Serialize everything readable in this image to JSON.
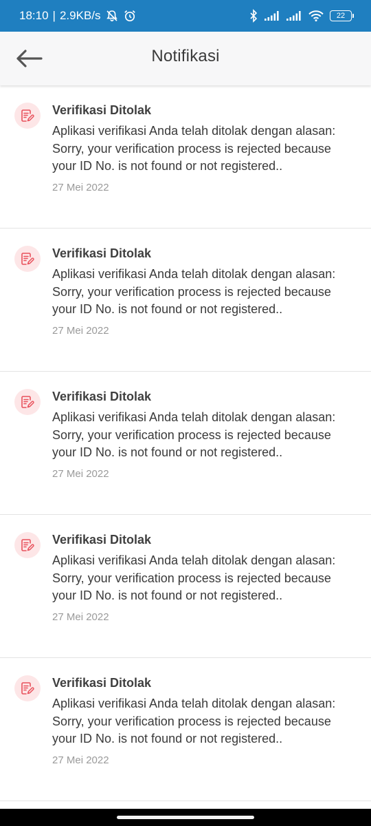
{
  "status_bar": {
    "time": "18:10",
    "separator": "|",
    "net_speed": "2.9KB/s",
    "battery_level": "22",
    "icons": [
      "mute-bell-icon",
      "alarm-icon",
      "bluetooth-icon",
      "signal-icon",
      "signal-icon",
      "wifi-icon",
      "battery-icon"
    ],
    "background_color": "#1f7fc0"
  },
  "header": {
    "title": "Notifikasi",
    "back_icon": "back-arrow-icon"
  },
  "notifications": [
    {
      "title": "Verifikasi Ditolak",
      "body": "Aplikasi verifikasi Anda telah ditolak dengan alasan: Sorry, your verification process is rejected because your ID No. is not found or not registered..",
      "date": "27 Mei 2022",
      "icon": "document-edit-icon"
    },
    {
      "title": "Verifikasi Ditolak",
      "body": "Aplikasi verifikasi Anda telah ditolak dengan alasan: Sorry, your verification process is rejected because your ID No. is not found or not registered..",
      "date": "27 Mei 2022",
      "icon": "document-edit-icon"
    },
    {
      "title": "Verifikasi Ditolak",
      "body": "Aplikasi verifikasi Anda telah ditolak dengan alasan: Sorry, your verification process is rejected because your ID No. is not found or not registered..",
      "date": "27 Mei 2022",
      "icon": "document-edit-icon"
    },
    {
      "title": "Verifikasi Ditolak",
      "body": "Aplikasi verifikasi Anda telah ditolak dengan alasan: Sorry, your verification process is rejected because your ID No. is not found or not registered..",
      "date": "27 Mei 2022",
      "icon": "document-edit-icon"
    },
    {
      "title": "Verifikasi Ditolak",
      "body": "Aplikasi verifikasi Anda telah ditolak dengan alasan: Sorry, your verification process is rejected because your ID No. is not found or not registered..",
      "date": "27 Mei 2022",
      "icon": "document-edit-icon"
    }
  ],
  "colors": {
    "icon_accent": "#e8505b",
    "icon_background": "#fde6e7"
  }
}
